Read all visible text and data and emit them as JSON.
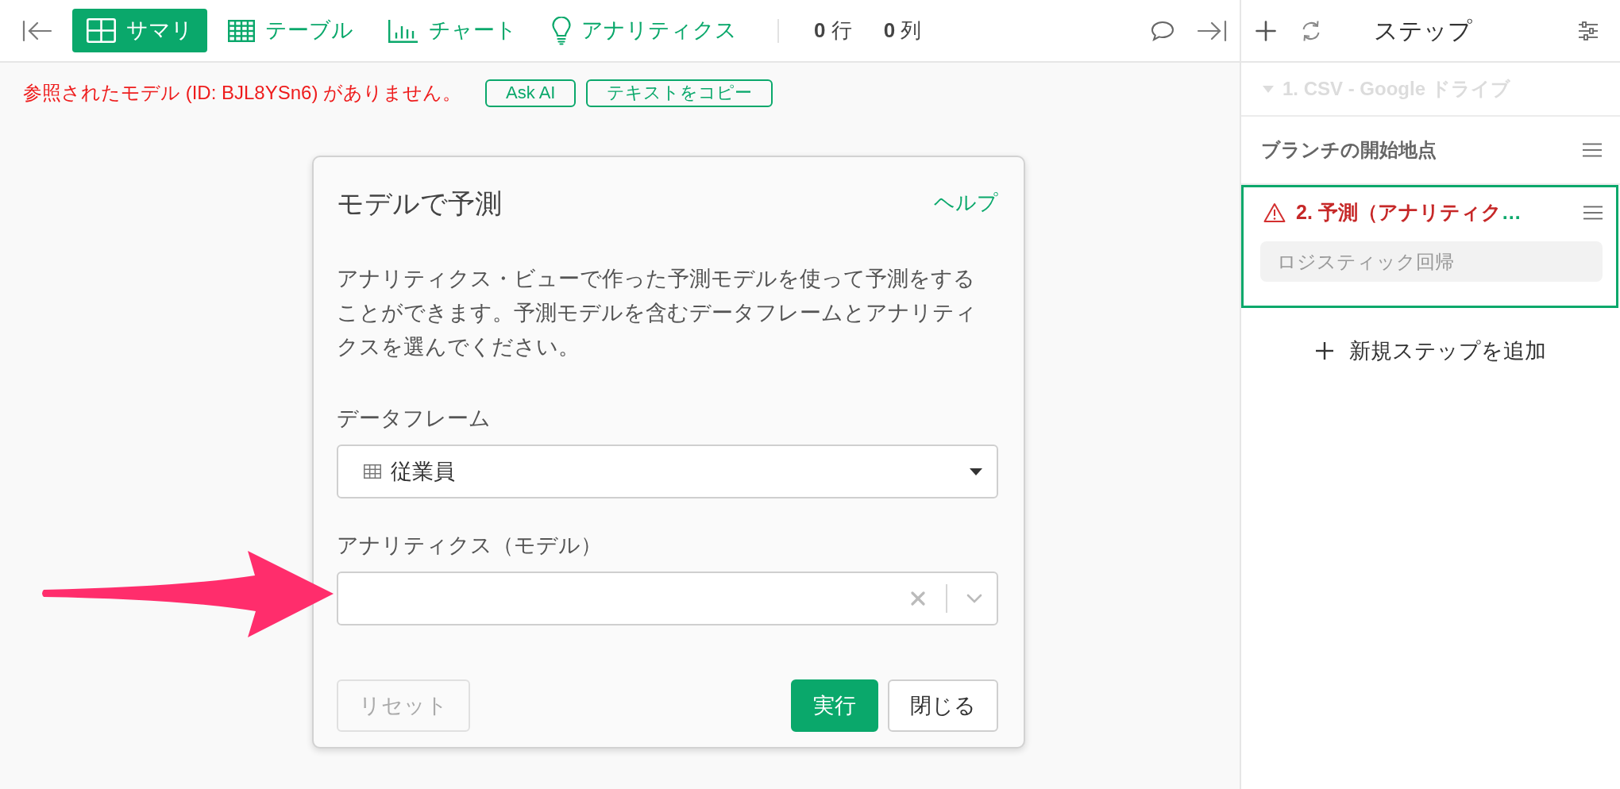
{
  "toolbar": {
    "tabs": [
      {
        "label": "サマリ",
        "kind": "summary",
        "selected": true
      },
      {
        "label": "テーブル",
        "kind": "table",
        "selected": false
      },
      {
        "label": "チャート",
        "kind": "chart",
        "selected": false
      },
      {
        "label": "アナリティクス",
        "kind": "analytics",
        "selected": false
      }
    ],
    "counts": [
      "**0** 行",
      "**0** 列"
    ]
  },
  "error_bar": {
    "message": "参照されたモデル (ID: BJL8YSn6) がありません。",
    "buttons": [
      "Ask AI",
      "テキストをコピー"
    ]
  },
  "dialog": {
    "title": "モデルで予測",
    "help_link": "ヘルプ",
    "description": "アナリティクス・ビューで作った予測モデルを使って予測をすることができます。予測モデルを含むデータフレームとアナリティクスを選んでください。",
    "fields": [
      {
        "label": "データフレーム",
        "kind": "dataframe",
        "value": "従業員"
      },
      {
        "label": "アナリティクス（モデル）",
        "kind": "model"
      }
    ],
    "buttons": [
      {
        "label": "リセット",
        "kind": "reset",
        "disabled": true
      },
      {
        "label": "実行",
        "kind": "run",
        "disabled": false
      },
      {
        "label": "閉じる",
        "kind": "close",
        "disabled": false
      }
    ]
  },
  "steps_panel": {
    "title": "ステップ",
    "steps": [
      {
        "kind": "source",
        "title": "1. CSV - Google ドライブ",
        "disabled": true,
        "selected": false
      },
      {
        "kind": "branch",
        "title": "ブランチの開始地点",
        "selected": false
      },
      {
        "kind": "step",
        "title": "2. 予測（アナリティク",
        "ellipsis": "…",
        "error": true,
        "selected": true,
        "detail": "ロジスティック回帰"
      }
    ],
    "add_step": "新規ステップを追加"
  }
}
